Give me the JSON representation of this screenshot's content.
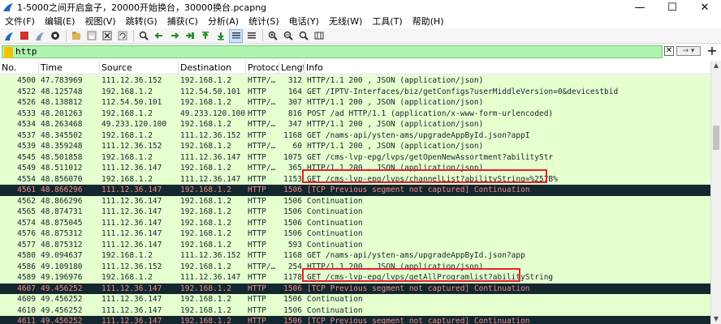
{
  "window": {
    "title": "1-5000之间开启盒子，20000开始换台，30000换台.pcapng",
    "minimize": "—",
    "maximize": "☐",
    "close": "✕"
  },
  "menu": [
    "文件(F)",
    "编辑(E)",
    "视图(V)",
    "跳转(G)",
    "捕获(C)",
    "分析(A)",
    "统计(S)",
    "电话(Y)",
    "无线(W)",
    "工具(T)",
    "帮助(H)"
  ],
  "filter": {
    "value": "http",
    "clear": "✕",
    "apply": "→ ▾",
    "add": "+"
  },
  "columns": [
    "No.",
    "Time",
    "Source",
    "Destination",
    "Protoco",
    "Length",
    "Info"
  ],
  "colors": {
    "row_bg": "#e6ffcf",
    "row_fg": "#12272e",
    "bad_bg": "#12272e",
    "bad_fg": "#f78787",
    "filter_bg": "#aff5af",
    "highlight_box": "#e8202a"
  },
  "packets": [
    {
      "no": "4500",
      "time": "47.783969",
      "src": "111.12.36.152",
      "dst": "192.168.1.2",
      "proto": "HTTP/…",
      "len": "312",
      "info": "HTTP/1.1 200  , JSON (application/json)",
      "type": "normal"
    },
    {
      "no": "4522",
      "time": "48.125748",
      "src": "192.168.1.2",
      "dst": "112.54.50.101",
      "proto": "HTTP",
      "len": "164",
      "info": "GET /IPTV-Interfaces/biz/getConfigs?userMiddleVersion=0&devicestbid",
      "type": "normal"
    },
    {
      "no": "4526",
      "time": "48.138812",
      "src": "112.54.50.101",
      "dst": "192.168.1.2",
      "proto": "HTTP/…",
      "len": "307",
      "info": "HTTP/1.1 200  , JSON (application/json)",
      "type": "normal"
    },
    {
      "no": "4533",
      "time": "48.201263",
      "src": "192.168.1.2",
      "dst": "49.233.120.100",
      "proto": "HTTP",
      "len": "816",
      "info": "POST /ad HTTP/1.1  (application/x-www-form-urlencoded)",
      "type": "normal"
    },
    {
      "no": "4534",
      "time": "48.263468",
      "src": "49.233.120.100",
      "dst": "192.168.1.2",
      "proto": "HTTP/…",
      "len": "347",
      "info": "HTTP/1.1 200  , JSON (application/json)",
      "type": "normal"
    },
    {
      "no": "4537",
      "time": "48.345502",
      "src": "192.168.1.2",
      "dst": "111.12.36.152",
      "proto": "HTTP",
      "len": "1168",
      "info": "GET /nams-api/ysten-ams/upgradeAppById.json?appI",
      "type": "normal"
    },
    {
      "no": "4539",
      "time": "48.359248",
      "src": "111.12.36.152",
      "dst": "192.168.1.2",
      "proto": "HTTP/…",
      "len": "60",
      "info": "HTTP/1.1 200  , JSON (application/json)",
      "type": "normal"
    },
    {
      "no": "4545",
      "time": "48.501858",
      "src": "192.168.1.2",
      "dst": "111.12.36.147",
      "proto": "HTTP",
      "len": "1075",
      "info": "GET /cms-lvp-epg/lvps/getOpenNewAssortment?abilityStr",
      "type": "normal"
    },
    {
      "no": "4549",
      "time": "48.511012",
      "src": "111.12.36.147",
      "dst": "192.168.1.2",
      "proto": "HTTP/…",
      "len": "365",
      "info": "HTTP/1.1 200  , JSON (application/json)",
      "type": "normal"
    },
    {
      "no": "4554",
      "time": "48.856070",
      "src": "192.168.1.2",
      "dst": "111.12.36.147",
      "proto": "HTTP",
      "len": "1153",
      "info": "GET /cms-lvp-epg/lvps/channelList?abilityString=%257B%",
      "type": "normal"
    },
    {
      "no": "4561",
      "time": "48.866296",
      "src": "111.12.36.147",
      "dst": "192.168.1.2",
      "proto": "HTTP",
      "len": "1506",
      "info": "[TCP Previous segment not captured] Continuation",
      "type": "bad"
    },
    {
      "no": "4562",
      "time": "48.866296",
      "src": "111.12.36.147",
      "dst": "192.168.1.2",
      "proto": "HTTP",
      "len": "1506",
      "info": "Continuation",
      "type": "normal"
    },
    {
      "no": "4565",
      "time": "48.874731",
      "src": "111.12.36.147",
      "dst": "192.168.1.2",
      "proto": "HTTP",
      "len": "1506",
      "info": "Continuation",
      "type": "normal"
    },
    {
      "no": "4574",
      "time": "48.875045",
      "src": "111.12.36.147",
      "dst": "192.168.1.2",
      "proto": "HTTP",
      "len": "1506",
      "info": "Continuation",
      "type": "normal"
    },
    {
      "no": "4576",
      "time": "48.875312",
      "src": "111.12.36.147",
      "dst": "192.168.1.2",
      "proto": "HTTP",
      "len": "1506",
      "info": "Continuation",
      "type": "normal"
    },
    {
      "no": "4577",
      "time": "48.875312",
      "src": "111.12.36.147",
      "dst": "192.168.1.2",
      "proto": "HTTP",
      "len": "593",
      "info": "Continuation",
      "type": "normal"
    },
    {
      "no": "4580",
      "time": "49.094637",
      "src": "192.168.1.2",
      "dst": "111.12.36.152",
      "proto": "HTTP",
      "len": "1168",
      "info": "GET /nams-api/ysten-ams/upgradeAppById.json?app",
      "type": "normal"
    },
    {
      "no": "4586",
      "time": "49.109180",
      "src": "111.12.36.152",
      "dst": "192.168.1.2",
      "proto": "HTTP/…",
      "len": "254",
      "info": "HTTP/1.1 200  , JSON (application/json)",
      "type": "normal"
    },
    {
      "no": "4589",
      "time": "49.196976",
      "src": "192.168.1.2",
      "dst": "111.12.36.147",
      "proto": "HTTP",
      "len": "1178",
      "info": "GET /cms-lvp-epg/lvps/getAllProgramlist?abilityString",
      "type": "normal"
    },
    {
      "no": "4607",
      "time": "49.456252",
      "src": "111.12.36.147",
      "dst": "192.168.1.2",
      "proto": "HTTP",
      "len": "1506",
      "info": "[TCP Previous segment not captured] Continuation",
      "type": "bad"
    },
    {
      "no": "4609",
      "time": "49.456252",
      "src": "111.12.36.147",
      "dst": "192.168.1.2",
      "proto": "HTTP",
      "len": "1506",
      "info": "Continuation",
      "type": "normal"
    },
    {
      "no": "4610",
      "time": "49.456252",
      "src": "111.12.36.147",
      "dst": "192.168.1.2",
      "proto": "HTTP",
      "len": "1506",
      "info": "Continuation",
      "type": "normal"
    },
    {
      "no": "4611",
      "time": "49.456252",
      "src": "111.12.36.147",
      "dst": "192.168.1.2",
      "proto": "HTTP",
      "len": "1506",
      "info": "[TCP Previous segment not captured] Continuation",
      "type": "bad"
    }
  ]
}
